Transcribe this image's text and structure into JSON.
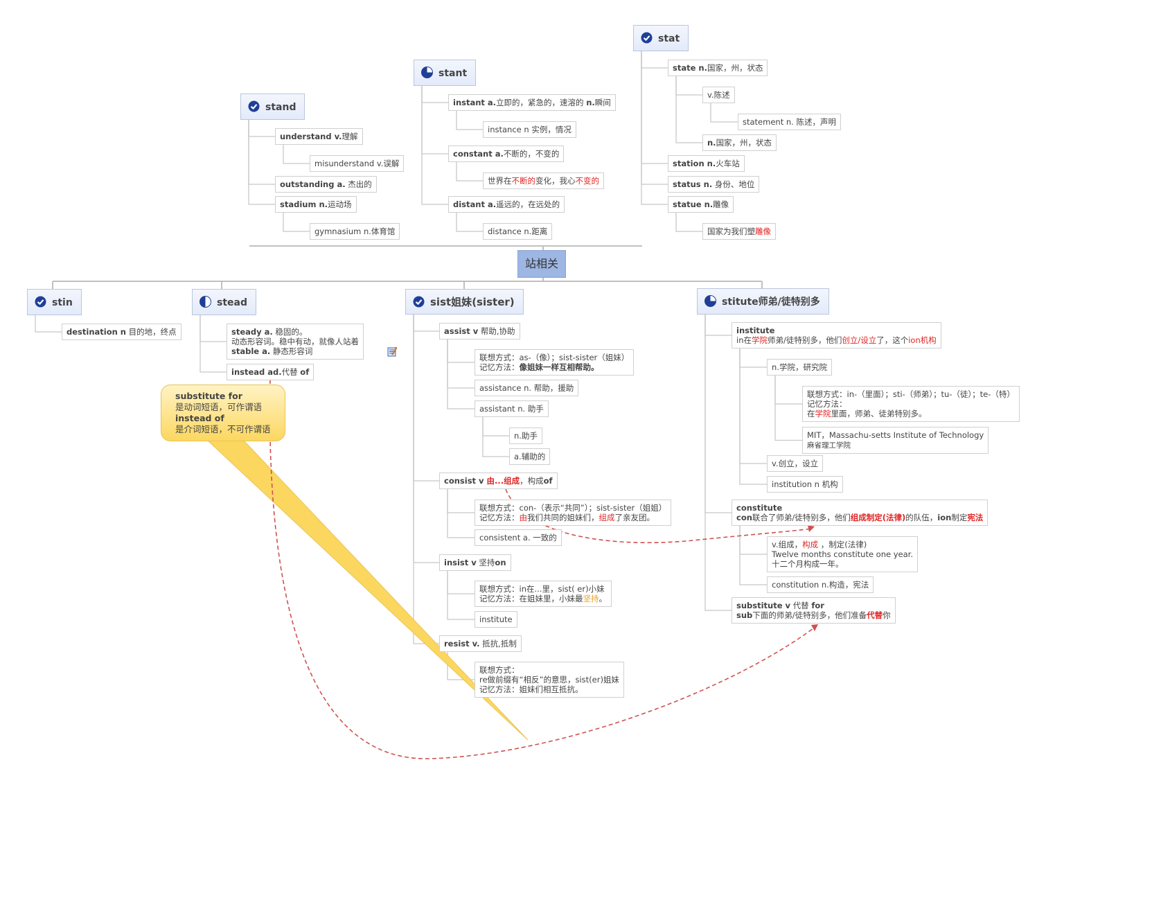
{
  "theme": {
    "accent": "#9db6e3",
    "topic_fill": "#e3eafa",
    "highlight_red": "#e02424",
    "highlight_orange": "#e8a020",
    "callout_fill": "#fcd760",
    "relationship_line": "#d05050"
  },
  "nodes": {
    "root": {
      "lines": [
        [
          [
            "站相关"
          ]
        ]
      ]
    },
    "stand": {
      "icon": "check-icon",
      "lines": [
        [
          [
            "stand"
          ]
        ]
      ]
    },
    "understand": {
      "lines": [
        [
          [
            "understand v.",
            "b"
          ],
          [
            "理解"
          ]
        ]
      ]
    },
    "misunderstand": {
      "lines": [
        [
          [
            "misunderstand v.误解"
          ]
        ]
      ]
    },
    "outstanding": {
      "lines": [
        [
          [
            "outstanding a.",
            "b"
          ],
          [
            " 杰出的"
          ]
        ]
      ]
    },
    "stadium": {
      "lines": [
        [
          [
            "stadium n.",
            "b"
          ],
          [
            "运动场"
          ]
        ]
      ]
    },
    "gymnasium": {
      "lines": [
        [
          [
            "gymnasium n.体育馆"
          ]
        ]
      ]
    },
    "stant": {
      "icon": "progress-three-quarter-icon",
      "lines": [
        [
          [
            "stant"
          ]
        ]
      ]
    },
    "instant": {
      "lines": [
        [
          [
            "instant a.",
            "b"
          ],
          [
            "立即的，紧急的，速溶的 "
          ],
          [
            "n.",
            "b"
          ],
          [
            "瞬间"
          ]
        ]
      ]
    },
    "instance": {
      "lines": [
        [
          [
            "instance n 实例，情况"
          ]
        ]
      ]
    },
    "constant": {
      "lines": [
        [
          [
            "constant a.",
            "b"
          ],
          [
            "不断的，不变的"
          ]
        ]
      ]
    },
    "constant_memo": {
      "lines": [
        [
          [
            "世界在"
          ],
          [
            "不断的",
            "r"
          ],
          [
            "变化，我心"
          ],
          [
            "不变的",
            "r"
          ]
        ]
      ]
    },
    "distant": {
      "lines": [
        [
          [
            "distant a.",
            "b"
          ],
          [
            "遥远的，在远处的"
          ]
        ]
      ]
    },
    "distance": {
      "lines": [
        [
          [
            "distance n.距离"
          ]
        ]
      ]
    },
    "stat": {
      "icon": "check-icon",
      "lines": [
        [
          [
            "stat"
          ]
        ]
      ]
    },
    "state": {
      "lines": [
        [
          [
            "state n.",
            "b"
          ],
          [
            "国家，州，状态"
          ]
        ]
      ]
    },
    "state_v": {
      "lines": [
        [
          [
            "v.陈述"
          ]
        ]
      ]
    },
    "statement": {
      "lines": [
        [
          [
            "statement n. 陈述，声明"
          ]
        ]
      ]
    },
    "state_n": {
      "lines": [
        [
          [
            "n.",
            "b"
          ],
          [
            "国家，州，状态"
          ]
        ]
      ]
    },
    "station": {
      "lines": [
        [
          [
            "station n.",
            "b"
          ],
          [
            "火车站"
          ]
        ]
      ]
    },
    "status": {
      "lines": [
        [
          [
            "status n.",
            "b"
          ],
          [
            " 身份、地位"
          ]
        ]
      ]
    },
    "statue": {
      "lines": [
        [
          [
            "statue n.",
            "b"
          ],
          [
            "雕像"
          ]
        ]
      ]
    },
    "statue_memo": {
      "lines": [
        [
          [
            "国家为我们塑"
          ],
          [
            "雕像",
            "r"
          ]
        ]
      ]
    },
    "stin": {
      "icon": "check-icon",
      "lines": [
        [
          [
            "stin"
          ]
        ]
      ]
    },
    "destination": {
      "lines": [
        [
          [
            "destination n",
            "b"
          ],
          [
            " 目的地，终点"
          ]
        ]
      ]
    },
    "stead": {
      "icon": "progress-half-icon",
      "lines": [
        [
          [
            "stead"
          ]
        ]
      ]
    },
    "steady": {
      "lines": [
        [
          [
            "steady a.",
            "b"
          ],
          [
            " 稳固的。"
          ]
        ],
        [
          [
            "动态形容词。稳中有动，就像人站着"
          ]
        ],
        [
          [
            "stable a.",
            "b"
          ],
          [
            " 静态形容词"
          ]
        ]
      ]
    },
    "instead": {
      "lines": [
        [
          [
            "instead ad.",
            "b"
          ],
          [
            "代替 "
          ],
          [
            "of",
            "b"
          ]
        ]
      ]
    },
    "callout": {
      "lines": [
        [
          [
            "substitute for",
            "b"
          ]
        ],
        [
          [
            "是动词短语，可作谓语"
          ]
        ],
        [
          [
            "instead of",
            "b"
          ]
        ],
        [
          [
            "是介词短语，不可作谓语"
          ]
        ]
      ]
    },
    "sist": {
      "icon": "check-icon",
      "lines": [
        [
          [
            "sist"
          ],
          [
            "姐妹"
          ],
          [
            "(sister)"
          ]
        ]
      ]
    },
    "assist": {
      "lines": [
        [
          [
            "assist v",
            "b"
          ],
          [
            " 帮助,协助"
          ]
        ]
      ]
    },
    "assist_memo": {
      "lines": [
        [
          [
            "联想方式：as-（像）；sist-sister（姐妹）"
          ]
        ],
        [
          [
            "记忆方法："
          ],
          [
            "像姐妹一样互相帮助。",
            "b"
          ]
        ]
      ]
    },
    "assistance": {
      "lines": [
        [
          [
            "assistance n. 帮助，援助"
          ]
        ]
      ]
    },
    "assistant": {
      "lines": [
        [
          [
            "assistant n. 助手"
          ]
        ]
      ]
    },
    "assistant_n": {
      "lines": [
        [
          [
            "n.助手"
          ]
        ]
      ]
    },
    "assistant_a": {
      "lines": [
        [
          [
            "a.辅助的"
          ]
        ]
      ]
    },
    "consist": {
      "lines": [
        [
          [
            "consist v ",
            "b"
          ],
          [
            "由...组成",
            "br"
          ],
          [
            "，构成"
          ],
          [
            "of",
            "b"
          ]
        ]
      ]
    },
    "consist_memo": {
      "lines": [
        [
          [
            "联想方式：con-（表示“共同”）；sist-sister（姐姐）"
          ]
        ],
        [
          [
            "记忆方法："
          ],
          [
            "由",
            "r"
          ],
          [
            "我们共同的姐妹们，"
          ],
          [
            "组成",
            "r"
          ],
          [
            "了亲友团。"
          ]
        ]
      ]
    },
    "consistent": {
      "lines": [
        [
          [
            "consistent a. 一致的"
          ]
        ]
      ]
    },
    "insist": {
      "lines": [
        [
          [
            "insist v",
            "b"
          ],
          [
            " 坚持"
          ],
          [
            "on",
            "b"
          ]
        ]
      ]
    },
    "insist_memo": {
      "lines": [
        [
          [
            "联想方式：in在...里，sist( er)小妹"
          ]
        ],
        [
          [
            "记忆方法：在姐妹里，小妹最"
          ],
          [
            "坚持",
            "o"
          ],
          [
            "。"
          ]
        ]
      ]
    },
    "insist_institute": {
      "lines": [
        [
          [
            "institute"
          ]
        ]
      ]
    },
    "resist": {
      "lines": [
        [
          [
            "resist v.",
            "b"
          ],
          [
            " 抵抗,抵制"
          ]
        ]
      ]
    },
    "resist_memo": {
      "lines": [
        [
          [
            "联想方式："
          ]
        ],
        [
          [
            "re做前缀有“相反”的意思，sist(er)姐妹"
          ]
        ],
        [
          [
            "记忆方法：姐妹们相互抵抗。"
          ]
        ]
      ]
    },
    "stitute": {
      "icon": "progress-three-quarter-icon",
      "lines": [
        [
          [
            "stitute"
          ],
          [
            "师弟/徒特别多"
          ]
        ]
      ]
    },
    "institute": {
      "lines": [
        [
          [
            "institute",
            "b"
          ]
        ],
        [
          [
            "in在"
          ],
          [
            "学院",
            "r"
          ],
          [
            "师弟/徒特别多，他们"
          ],
          [
            "创立/设立",
            "r"
          ],
          [
            "了，这个"
          ],
          [
            "ion机构",
            "r"
          ]
        ]
      ]
    },
    "institute_n": {
      "lines": [
        [
          [
            "n.学院，研究院"
          ]
        ]
      ]
    },
    "institute_memo": {
      "lines": [
        [
          [
            "联想方式：in-（里面）；sti-（师弟）；tu-（徒）；te-（特）"
          ]
        ],
        [
          [
            "记忆方法："
          ]
        ],
        [
          [
            "在"
          ],
          [
            "学院",
            "r"
          ],
          [
            "里面，师弟、徒弟特别多。"
          ]
        ]
      ]
    },
    "mit": {
      "lines": [
        [
          [
            "MIT，Massachu-setts Institute of Technology"
          ]
        ],
        [
          [
            "麻省理工学院",
            "small"
          ]
        ]
      ]
    },
    "institute_v": {
      "lines": [
        [
          [
            "v.创立，设立"
          ]
        ]
      ]
    },
    "institution": {
      "lines": [
        [
          [
            "institution n 机构"
          ]
        ]
      ]
    },
    "constitute": {
      "lines": [
        [
          [
            "constitute",
            "b"
          ]
        ],
        [
          [
            "con",
            "b"
          ],
          [
            "联合了师弟/徒特别多，他们"
          ],
          [
            "组成制定(法律)",
            "br"
          ],
          [
            "的队伍，"
          ],
          [
            "ion",
            "b"
          ],
          [
            "制定"
          ],
          [
            "宪法",
            "br"
          ]
        ]
      ]
    },
    "constitute_v": {
      "lines": [
        [
          [
            "v.组成，"
          ],
          [
            "构成",
            "r"
          ],
          [
            " ，制定(法律)"
          ]
        ],
        [
          [
            "Twelve months constitute one year."
          ]
        ],
        [
          [
            "十二个月构成一年。"
          ]
        ]
      ]
    },
    "constitution": {
      "lines": [
        [
          [
            "constitution n.构造，宪法"
          ]
        ]
      ]
    },
    "substitute": {
      "lines": [
        [
          [
            "substitute v",
            "b"
          ],
          [
            " 代替 "
          ],
          [
            "for",
            "b"
          ]
        ],
        [
          [
            "sub",
            "b"
          ],
          [
            "下面的师弟/徒特别多，他们准备"
          ],
          [
            "代替",
            "br"
          ],
          [
            "你"
          ]
        ]
      ]
    }
  }
}
